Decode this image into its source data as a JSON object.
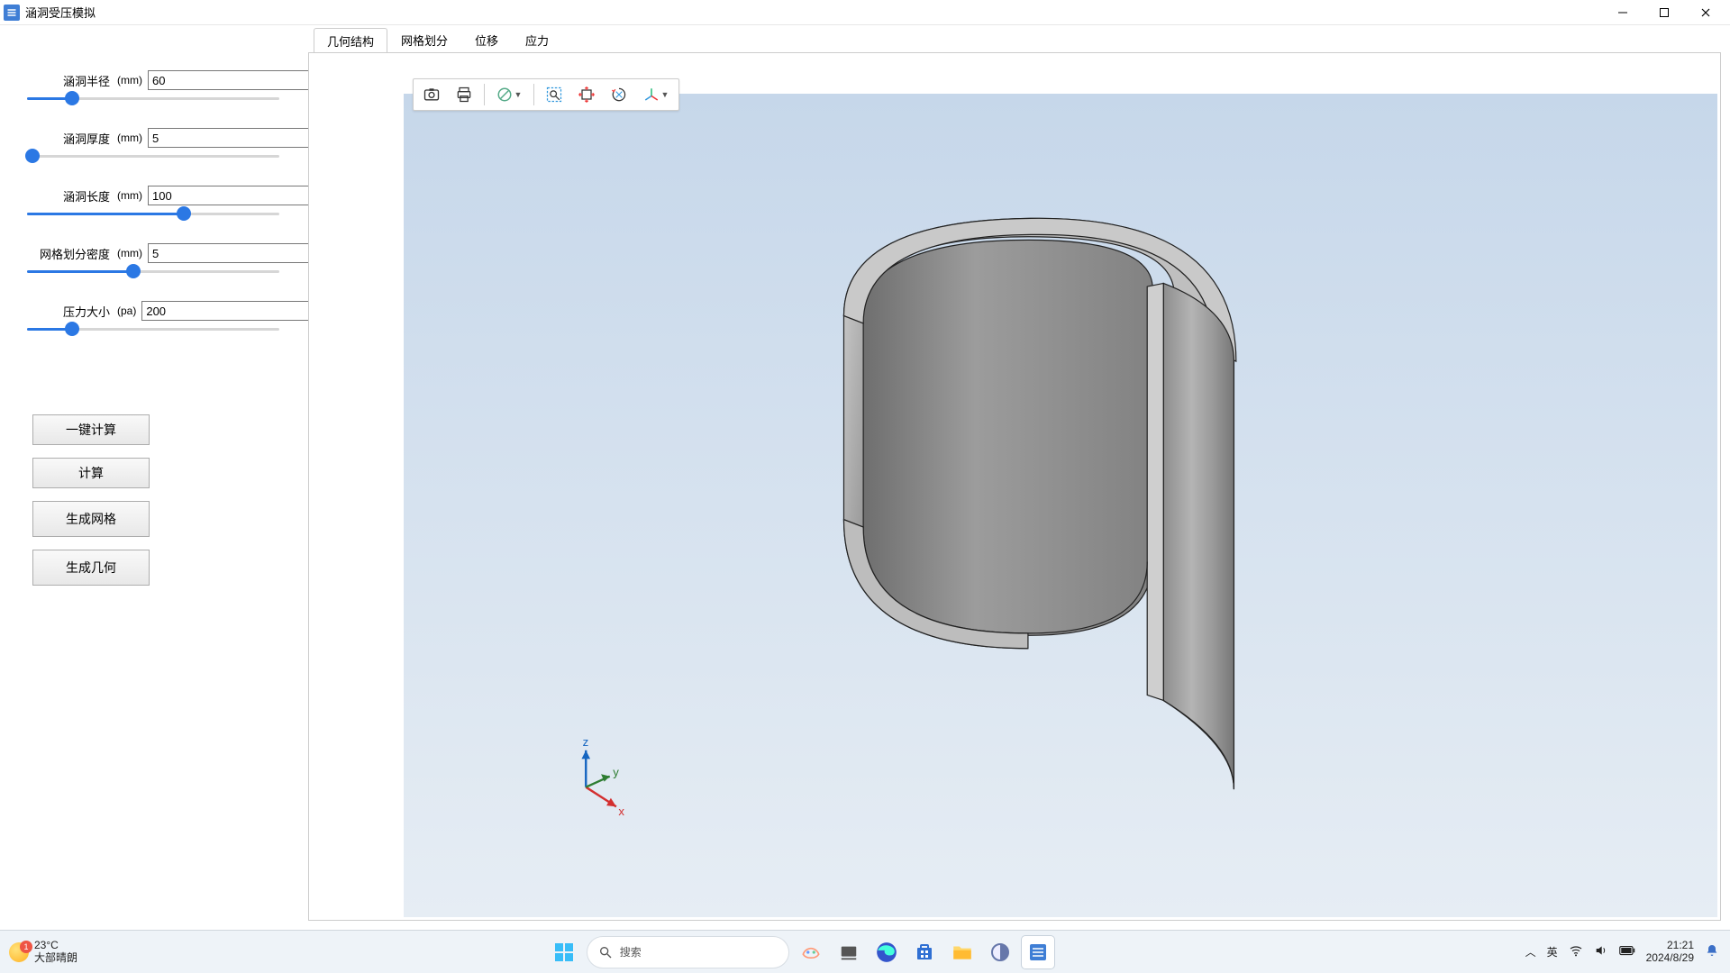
{
  "window": {
    "title": "涵洞受压模拟"
  },
  "sidebar": {
    "params": [
      {
        "label": "涵洞半径",
        "unit": "(mm)",
        "value": "60",
        "percent": 18
      },
      {
        "label": "涵洞厚度",
        "unit": "(mm)",
        "value": "5",
        "percent": 2
      },
      {
        "label": "涵洞长度",
        "unit": "(mm)",
        "value": "100",
        "percent": 62
      },
      {
        "label": "网格划分密度",
        "unit": "(mm)",
        "value": "5",
        "percent": 42
      },
      {
        "label": "压力大小",
        "unit": "(pa)",
        "value": "200",
        "percent": 18
      }
    ],
    "buttons": {
      "one_click": "一键计算",
      "compute": "计算",
      "mesh": "生成网格",
      "geometry": "生成几何"
    }
  },
  "tabs": {
    "items": [
      {
        "id": "geometry",
        "label": "几何结构",
        "active": true
      },
      {
        "id": "mesh",
        "label": "网格划分",
        "active": false
      },
      {
        "id": "disp",
        "label": "位移",
        "active": false
      },
      {
        "id": "stress",
        "label": "应力",
        "active": false
      }
    ]
  },
  "taskbar": {
    "weather_temp": "23°C",
    "weather_desc": "大部晴朗",
    "weather_badge": "1",
    "search_placeholder": "搜索",
    "ime": "英",
    "time": "21:21",
    "date": "2024/8/29"
  },
  "viewport": {
    "axis": {
      "x": "x",
      "y": "y",
      "z": "z"
    }
  }
}
